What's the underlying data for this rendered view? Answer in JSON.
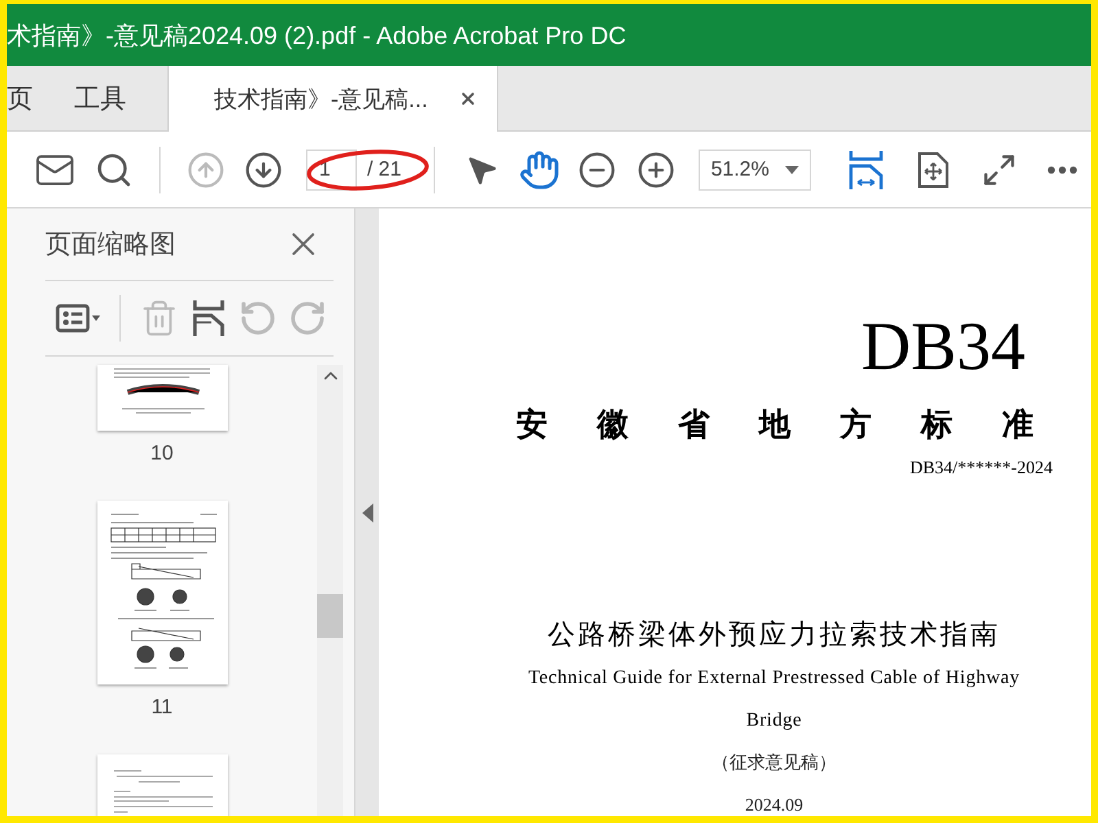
{
  "window": {
    "title": "术指南》-意见稿2024.09 (2).pdf - Adobe Acrobat Pro DC"
  },
  "tabs": [
    {
      "label": "页",
      "selected": false
    },
    {
      "label": "工具",
      "selected": false
    },
    {
      "label": "技术指南》-意见稿...",
      "selected": true
    }
  ],
  "toolbar": {
    "items": [
      {
        "kind": "mail"
      },
      {
        "kind": "search"
      },
      {
        "kind": "separator"
      },
      {
        "kind": "prev_page",
        "disabled": true
      },
      {
        "kind": "next_page",
        "disabled": false
      },
      {
        "kind": "page_field"
      },
      {
        "kind": "separator"
      },
      {
        "kind": "select_tool",
        "selected": false
      },
      {
        "kind": "hand_tool",
        "selected": true
      },
      {
        "kind": "zoom_out"
      },
      {
        "kind": "zoom_in"
      },
      {
        "kind": "zoom_field"
      },
      {
        "kind": "fit_width",
        "selected": true
      },
      {
        "kind": "fit_page",
        "selected": false
      },
      {
        "kind": "full_screen"
      },
      {
        "kind": "more"
      }
    ],
    "page": "1",
    "page_total": "/ 21",
    "zoom": "51.2%"
  },
  "sidebar": {
    "title": "页面缩略图",
    "tools": [
      {
        "kind": "options",
        "disabled": false
      },
      {
        "kind": "separator"
      },
      {
        "kind": "delete",
        "disabled": true
      },
      {
        "kind": "insert",
        "disabled": false
      },
      {
        "kind": "rotate_left",
        "disabled": true
      },
      {
        "kind": "rotate_right",
        "disabled": true
      }
    ],
    "thumbnails": [
      {
        "kind": "figure",
        "label": "10"
      },
      {
        "kind": "diagram",
        "label": "11"
      },
      {
        "kind": "text"
      }
    ]
  },
  "document": {
    "code": "DB34",
    "authority": "安徽省地方标准",
    "number": "DB34/******-2024",
    "title_zh": "公路桥梁体外预应力拉索技术指南",
    "title_en": "Technical Guide for External Prestressed Cable of Highway Bridge",
    "stage": "（征求意见稿）",
    "date": "2024.09"
  }
}
